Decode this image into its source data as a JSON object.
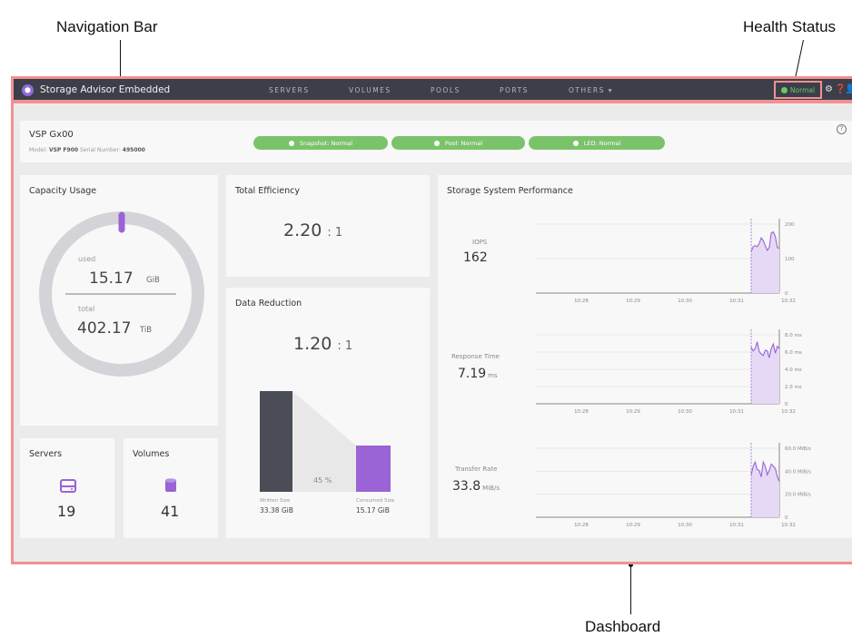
{
  "callouts": {
    "navigation_bar": "Navigation Bar",
    "health_status": "Health Status",
    "dashboard": "Dashboard"
  },
  "navbar": {
    "app_title": "Storage Advisor Embedded",
    "items": [
      "SERVERS",
      "VOLUMES",
      "POOLS",
      "PORTS",
      "OTHERS ▾"
    ],
    "health": "Normal",
    "icons": [
      "gear-icon",
      "help-icon",
      "user-icon"
    ]
  },
  "system": {
    "name": "VSP Gx00",
    "model_label": "Model:",
    "model": "VSP F900",
    "serial_label": "Serial Number:",
    "serial": "495000",
    "statuses": [
      "Snapshot: Normal",
      "Pool: Normal",
      "LED: Normal"
    ],
    "status_color": "#7bc36b"
  },
  "capacity": {
    "title": "Capacity Usage",
    "used_label": "used",
    "used_value": "15.17",
    "used_unit": "GiB",
    "total_label": "total",
    "total_value": "402.17",
    "total_unit": "TiB",
    "used_color": "#9a63d6",
    "ring_color": "#d4d4d8"
  },
  "servers": {
    "title": "Servers",
    "count": "19",
    "icon": "server-icon"
  },
  "volumes": {
    "title": "Volumes",
    "count": "41",
    "icon": "database-icon"
  },
  "efficiency": {
    "title": "Total Efficiency",
    "ratio": "2.20",
    "suffix": ": 1"
  },
  "reduction": {
    "title": "Data Reduction",
    "ratio": "1.20",
    "suffix": ": 1",
    "percent": "45 %",
    "written_label": "Written Size",
    "written_value": "33.38 GiB",
    "consumed_label": "Consumed Size",
    "consumed_value": "15.17 GiB",
    "written_color": "#4a4d55",
    "consumed_color": "#9a63d6"
  },
  "performance": {
    "title": "Storage System Performance",
    "x_ticks": [
      "10:28",
      "10:29",
      "10:30",
      "10:31",
      "10:32"
    ],
    "accent": "#9a63d6",
    "fill": "#e6d9f5",
    "charts": [
      {
        "label": "IOPS",
        "value": "162",
        "unit": "",
        "y_ticks": [
          "200",
          "100",
          "0"
        ],
        "ymax": 250,
        "values": [
          150,
          168,
          172,
          168,
          180,
          200,
          190,
          172,
          155,
          165,
          218,
          222,
          205,
          165,
          162
        ]
      },
      {
        "label": "Response Time",
        "value": "7.19",
        "unit": "ms",
        "y_ticks": [
          "8.0 ms",
          "6.0 ms",
          "4.0 ms",
          "2.0 ms",
          "0"
        ],
        "ymax": 9,
        "values": [
          7.4,
          6.9,
          7.2,
          8.1,
          6.8,
          6.5,
          6.3,
          7.0,
          6.9,
          6.0,
          7.2,
          7.8,
          6.6,
          7.5,
          7.19
        ]
      },
      {
        "label": "Transfer Rate",
        "value": "33.8",
        "unit": "MiB/s",
        "y_ticks": [
          "60.0 MiB/s",
          "40.0 MiB/s",
          "20.0 MiB/s",
          "0"
        ],
        "ymax": 65,
        "values": [
          40,
          48,
          52,
          45,
          44,
          38,
          52,
          48,
          40,
          44,
          50,
          48,
          46,
          38,
          33.8
        ]
      }
    ]
  }
}
